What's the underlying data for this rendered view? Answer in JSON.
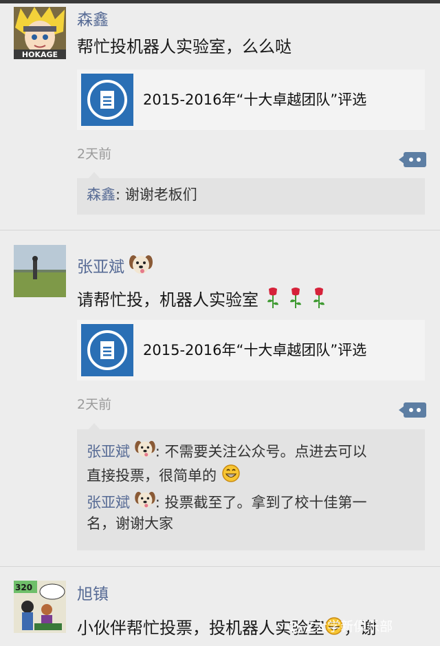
{
  "posts": [
    {
      "name": "森鑫",
      "text": "帮忙投机器人实验室，么么哒",
      "card_title": "2015-2016年“十大卓越团队”评选",
      "time": "2天前",
      "avatar_text": "HOKAGE",
      "comments": [
        {
          "name": "森鑫",
          "sep": ": ",
          "text": "谢谢老板们"
        }
      ]
    },
    {
      "name": "张亚斌",
      "text": "请帮忙投，机器人实验室",
      "card_title": "2015-2016年“十大卓越团队”评选",
      "time": "2天前",
      "comments": [
        {
          "name": "张亚斌",
          "sep": ": ",
          "line1": "不需要关注公众号。点进去可以",
          "line2": "直接投票，很简单的"
        },
        {
          "name": "张亚斌",
          "sep": ": ",
          "line1": "投票截至了。拿到了校十佳第一",
          "line2": "名，谢谢大家"
        }
      ]
    },
    {
      "name": "旭镇",
      "text": "小伙伴帮忙投票，投机器人实验室",
      "text_tail": "，谢"
    }
  ],
  "watermark": "Z大学新俱乐部",
  "colors": {
    "name": "#576b95",
    "card_icon": "#2a6fb5",
    "comment_bg": "#e3e3e3",
    "page_bg": "#ededed"
  }
}
